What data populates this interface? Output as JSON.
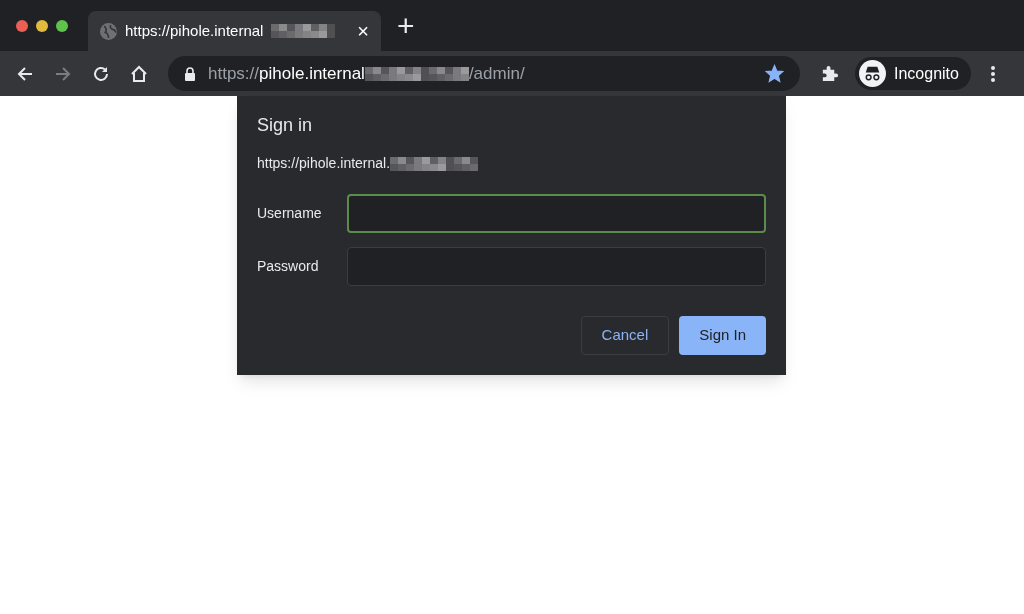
{
  "tab": {
    "title": "https://pihole.internal",
    "close": "×",
    "new_tab": "+"
  },
  "toolbar": {
    "address": {
      "scheme": "https://",
      "host": "pihole.internal",
      "path": "/admin/"
    },
    "bookmarked": true,
    "profile": "Incognito"
  },
  "dialog": {
    "title": "Sign in",
    "origin": "https://pihole.internal.",
    "fields": [
      {
        "label": "Username",
        "focused": true
      },
      {
        "label": "Password",
        "focused": false
      }
    ],
    "buttons": [
      {
        "label": "Cancel",
        "kind": "secondary"
      },
      {
        "label": "Sign In",
        "kind": "primary"
      }
    ]
  }
}
